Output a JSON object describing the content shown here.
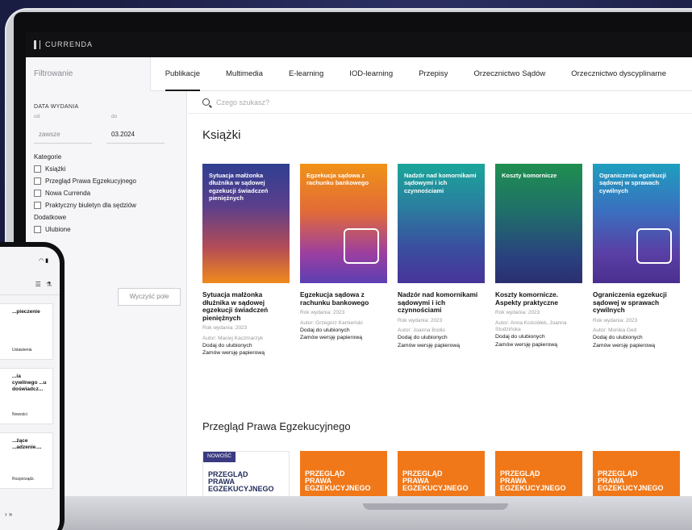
{
  "app": {
    "brand": "CURRENDA"
  },
  "nav": {
    "filter_title": "Filtrowanie",
    "tabs": [
      "Publikacje",
      "Multimedia",
      "E-learning",
      "IOD-learning",
      "Przepisy",
      "Orzecznictwo Sądów",
      "Orzecznictwo dyscyplinarne"
    ]
  },
  "sidebar": {
    "date_heading": "DATA WYDANIA",
    "from_label": "od",
    "to_label": "do",
    "from_value": "zawsze",
    "to_value": "03.2024",
    "categories_label": "Kategorie",
    "categories": [
      "Książki",
      "Przegląd Prawa Egzekucyjnego",
      "Nowa Currenda",
      "Praktyczny biuletyn dla sędziów"
    ],
    "extra_label": "Dodatkowe",
    "extras": [
      "Ulubione"
    ],
    "clear_button": "Wyczyść pole"
  },
  "search": {
    "placeholder": "Czego szukasz?"
  },
  "sections": {
    "books_title": "Książki",
    "journal_title": "Przegląd Prawa Egzekucyjnego"
  },
  "books": [
    {
      "cover_text": "Sytuacja małżonka dłużnika w sądowej egzekucji świadczeń pieniężnych",
      "title": "Sytuacja małżonka dłużnika w sądowej egzekucji świadczeń pieniężnych",
      "year": "Rok wydania: 2023",
      "author": "Autor: Maciej Kaczmarzyk",
      "fav": "Dodaj do ulubionych",
      "order": "Zamów wersję papierową",
      "gradient": "linear-gradient(180deg,#2f3f91 0%,#5a3f8c 35%,#b34c57 70%,#f08a1c 100%)"
    },
    {
      "cover_text": "Egzekucja sądowa z rachunku bankowego",
      "title": "Egzekucja sądowa z rachunku bankowego",
      "year": "Rok wydania: 2023",
      "author": "Autor: Grzegorz Kamieński",
      "fav": "Dodaj do ulubionych",
      "order": "Zamów wersję papierową",
      "gradient": "linear-gradient(180deg,#f09216 0%,#e26b38 40%,#9c3fa0 75%,#5b3fb3 100%)"
    },
    {
      "cover_text": "Nadzór nad komornikami sądowymi i ich czynnościami",
      "title": "Nadzór nad komornikami sądowymi i ich czynnościami",
      "year": "Rok wydania: 2023",
      "author": "Autor: Joanna Bodio",
      "fav": "Dodaj do ulubionych",
      "order": "Zamów wersję papierową",
      "gradient": "linear-gradient(180deg,#1aa69a 0%,#2a7f9f 35%,#3a4f9f 70%,#47349a 100%)"
    },
    {
      "cover_text": "Koszty komornicze",
      "title": "Koszty komornicze. Aspekty praktyczne",
      "year": "Rok wydania: 2023",
      "author": "Autor: Anna Kościółek, Joanna Studzińska",
      "fav": "Dodaj do ulubionych",
      "order": "Zamów wersję papierową",
      "gradient": "linear-gradient(180deg,#1f8f4f 0%,#1f6f6a 40%,#2a3f7f 80%,#2a2f6f 100%)"
    },
    {
      "cover_text": "Ograniczenia egzekucji sądowej w sprawach cywilnych",
      "title": "Ograniczenia egzekucji sądowej w sprawach cywilnych",
      "year": "Rok wydania: 2023",
      "author": "Autor: Monika Ged",
      "fav": "Dodaj do ulubionych",
      "order": "Zamów wersję papierową",
      "gradient": "linear-gradient(180deg,#1e9fbf 0%,#3a6fbf 40%,#5a3fa5 75%,#4a2f8f 100%)"
    }
  ],
  "journals": {
    "badge": "NOWOŚĆ",
    "title_line1": "PRZEGLĄD",
    "title_line2": "PRAWA",
    "title_line3": "EGZEKUCYJNEGO"
  },
  "phone": {
    "cards": [
      {
        "title": "...pieczenie",
        "label": "Ustawienia"
      },
      {
        "title": "...ia cywilnego ...u doświadcz...",
        "label": "Nowości"
      },
      {
        "title": "...żące ...adzenie....",
        "label": "Rozporządz."
      }
    ],
    "pager": "› »"
  }
}
